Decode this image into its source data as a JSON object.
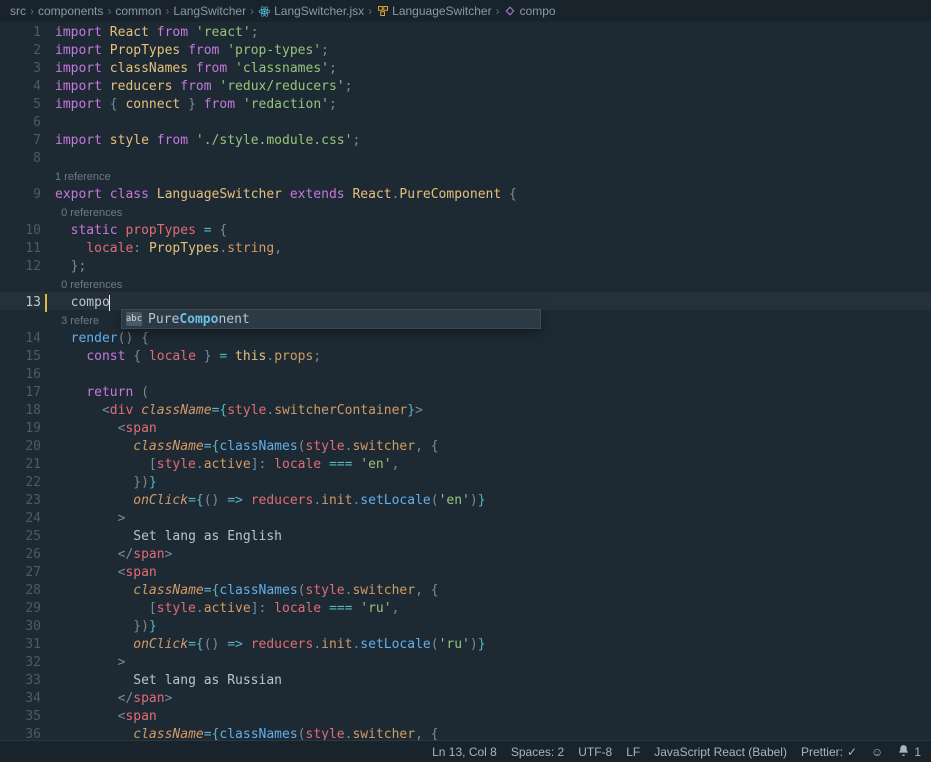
{
  "breadcrumb": [
    {
      "label": "src",
      "icon": null
    },
    {
      "label": "components",
      "icon": null
    },
    {
      "label": "common",
      "icon": null
    },
    {
      "label": "LangSwitcher",
      "icon": null
    },
    {
      "label": "LangSwitcher.jsx",
      "icon": "react-file-icon"
    },
    {
      "label": "LanguageSwitcher",
      "icon": "symbol-class-icon"
    },
    {
      "label": "compo",
      "icon": "symbol-method-icon"
    }
  ],
  "codelens": {
    "ref0": "0 references",
    "ref1": "1 reference",
    "ref3": "3 refere"
  },
  "lines": {
    "1": [
      [
        "kw",
        "import"
      ],
      [
        "plain",
        " "
      ],
      [
        "def",
        "React"
      ],
      [
        "plain",
        " "
      ],
      [
        "kw",
        "from"
      ],
      [
        "plain",
        " "
      ],
      [
        "str",
        "'react'"
      ],
      [
        "punct",
        ";"
      ]
    ],
    "2": [
      [
        "kw",
        "import"
      ],
      [
        "plain",
        " "
      ],
      [
        "def",
        "PropTypes"
      ],
      [
        "plain",
        " "
      ],
      [
        "kw",
        "from"
      ],
      [
        "plain",
        " "
      ],
      [
        "str",
        "'prop-types'"
      ],
      [
        "punct",
        ";"
      ]
    ],
    "3": [
      [
        "kw",
        "import"
      ],
      [
        "plain",
        " "
      ],
      [
        "def",
        "classNames"
      ],
      [
        "plain",
        " "
      ],
      [
        "kw",
        "from"
      ],
      [
        "plain",
        " "
      ],
      [
        "str",
        "'classnames'"
      ],
      [
        "punct",
        ";"
      ]
    ],
    "4": [
      [
        "kw",
        "import"
      ],
      [
        "plain",
        " "
      ],
      [
        "def",
        "reducers"
      ],
      [
        "plain",
        " "
      ],
      [
        "kw",
        "from"
      ],
      [
        "plain",
        " "
      ],
      [
        "str",
        "'redux/reducers'"
      ],
      [
        "punct",
        ";"
      ]
    ],
    "5": [
      [
        "kw",
        "import"
      ],
      [
        "plain",
        " "
      ],
      [
        "punct",
        "{ "
      ],
      [
        "def",
        "connect"
      ],
      [
        "punct",
        " }"
      ],
      [
        "plain",
        " "
      ],
      [
        "kw",
        "from"
      ],
      [
        "plain",
        " "
      ],
      [
        "str",
        "'redaction'"
      ],
      [
        "punct",
        ";"
      ]
    ],
    "6": [],
    "7": [
      [
        "kw",
        "import"
      ],
      [
        "plain",
        " "
      ],
      [
        "def",
        "style"
      ],
      [
        "plain",
        " "
      ],
      [
        "kw",
        "from"
      ],
      [
        "plain",
        " "
      ],
      [
        "str",
        "'./style.module.css'"
      ],
      [
        "punct",
        ";"
      ]
    ],
    "8": [],
    "9": [
      [
        "kw",
        "export"
      ],
      [
        "plain",
        " "
      ],
      [
        "kw",
        "class"
      ],
      [
        "plain",
        " "
      ],
      [
        "def",
        "LanguageSwitcher"
      ],
      [
        "plain",
        " "
      ],
      [
        "kw",
        "extends"
      ],
      [
        "plain",
        " "
      ],
      [
        "def",
        "React"
      ],
      [
        "punct",
        "."
      ],
      [
        "def",
        "PureComponent"
      ],
      [
        "plain",
        " "
      ],
      [
        "punct",
        "{"
      ]
    ],
    "10": [
      [
        "plain",
        "  "
      ],
      [
        "kw",
        "static"
      ],
      [
        "plain",
        " "
      ],
      [
        "id",
        "propTypes"
      ],
      [
        "plain",
        " "
      ],
      [
        "op",
        "="
      ],
      [
        "plain",
        " "
      ],
      [
        "punct",
        "{"
      ]
    ],
    "11": [
      [
        "plain",
        "    "
      ],
      [
        "id",
        "locale"
      ],
      [
        "punct",
        ":"
      ],
      [
        "plain",
        " "
      ],
      [
        "def",
        "PropTypes"
      ],
      [
        "punct",
        "."
      ],
      [
        "prop",
        "string"
      ],
      [
        "punct",
        ","
      ]
    ],
    "12": [
      [
        "plain",
        "  "
      ],
      [
        "punct",
        "};"
      ]
    ],
    "13": [
      [
        "plain",
        "  "
      ],
      [
        "plain",
        "compo"
      ]
    ],
    "14": [
      [
        "plain",
        "  "
      ],
      [
        "fn",
        "render"
      ],
      [
        "punct",
        "()"
      ],
      [
        "plain",
        " "
      ],
      [
        "punct",
        "{"
      ]
    ],
    "15": [
      [
        "plain",
        "    "
      ],
      [
        "kw",
        "const"
      ],
      [
        "plain",
        " "
      ],
      [
        "punct",
        "{ "
      ],
      [
        "id",
        "locale"
      ],
      [
        "punct",
        " }"
      ],
      [
        "plain",
        " "
      ],
      [
        "op",
        "="
      ],
      [
        "plain",
        " "
      ],
      [
        "this",
        "this"
      ],
      [
        "punct",
        "."
      ],
      [
        "prop",
        "props"
      ],
      [
        "punct",
        ";"
      ]
    ],
    "16": [],
    "17": [
      [
        "plain",
        "    "
      ],
      [
        "kw",
        "return"
      ],
      [
        "plain",
        " "
      ],
      [
        "punct",
        "("
      ]
    ],
    "18": [
      [
        "plain",
        "      "
      ],
      [
        "punct",
        "<"
      ],
      [
        "tag",
        "div"
      ],
      [
        "plain",
        " "
      ],
      [
        "attr",
        "className"
      ],
      [
        "op",
        "="
      ],
      [
        "jsxbr",
        "{"
      ],
      [
        "id",
        "style"
      ],
      [
        "punct",
        "."
      ],
      [
        "prop",
        "switcherContainer"
      ],
      [
        "jsxbr",
        "}"
      ],
      [
        "punct",
        ">"
      ]
    ],
    "19": [
      [
        "plain",
        "        "
      ],
      [
        "punct",
        "<"
      ],
      [
        "tag",
        "span"
      ]
    ],
    "20": [
      [
        "plain",
        "          "
      ],
      [
        "attr",
        "className"
      ],
      [
        "op",
        "="
      ],
      [
        "jsxbr",
        "{"
      ],
      [
        "fn",
        "classNames"
      ],
      [
        "punct",
        "("
      ],
      [
        "id",
        "style"
      ],
      [
        "punct",
        "."
      ],
      [
        "prop",
        "switcher"
      ],
      [
        "punct",
        ","
      ],
      [
        "plain",
        " "
      ],
      [
        "punct",
        "{"
      ]
    ],
    "21": [
      [
        "plain",
        "            "
      ],
      [
        "punct",
        "["
      ],
      [
        "id",
        "style"
      ],
      [
        "punct",
        "."
      ],
      [
        "prop",
        "active"
      ],
      [
        "punct",
        "]"
      ],
      [
        "punct",
        ":"
      ],
      [
        "plain",
        " "
      ],
      [
        "id",
        "locale"
      ],
      [
        "plain",
        " "
      ],
      [
        "op",
        "==="
      ],
      [
        "plain",
        " "
      ],
      [
        "str",
        "'en'"
      ],
      [
        "punct",
        ","
      ]
    ],
    "22": [
      [
        "plain",
        "          "
      ],
      [
        "punct",
        "})"
      ],
      [
        "jsxbr",
        "}"
      ]
    ],
    "23": [
      [
        "plain",
        "          "
      ],
      [
        "attr",
        "onClick"
      ],
      [
        "op",
        "="
      ],
      [
        "jsxbr",
        "{"
      ],
      [
        "punct",
        "()"
      ],
      [
        "plain",
        " "
      ],
      [
        "op",
        "=>"
      ],
      [
        "plain",
        " "
      ],
      [
        "id",
        "reducers"
      ],
      [
        "punct",
        "."
      ],
      [
        "prop",
        "init"
      ],
      [
        "punct",
        "."
      ],
      [
        "fn",
        "setLocale"
      ],
      [
        "punct",
        "("
      ],
      [
        "str",
        "'en'"
      ],
      [
        "punct",
        ")"
      ],
      [
        "jsxbr",
        "}"
      ]
    ],
    "24": [
      [
        "plain",
        "        "
      ],
      [
        "punct",
        ">"
      ]
    ],
    "25": [
      [
        "plain",
        "          "
      ],
      [
        "plain",
        "Set lang as English"
      ]
    ],
    "26": [
      [
        "plain",
        "        "
      ],
      [
        "punct",
        "</"
      ],
      [
        "tag",
        "span"
      ],
      [
        "punct",
        ">"
      ]
    ],
    "27": [
      [
        "plain",
        "        "
      ],
      [
        "punct",
        "<"
      ],
      [
        "tag",
        "span"
      ]
    ],
    "28": [
      [
        "plain",
        "          "
      ],
      [
        "attr",
        "className"
      ],
      [
        "op",
        "="
      ],
      [
        "jsxbr",
        "{"
      ],
      [
        "fn",
        "classNames"
      ],
      [
        "punct",
        "("
      ],
      [
        "id",
        "style"
      ],
      [
        "punct",
        "."
      ],
      [
        "prop",
        "switcher"
      ],
      [
        "punct",
        ","
      ],
      [
        "plain",
        " "
      ],
      [
        "punct",
        "{"
      ]
    ],
    "29": [
      [
        "plain",
        "            "
      ],
      [
        "punct",
        "["
      ],
      [
        "id",
        "style"
      ],
      [
        "punct",
        "."
      ],
      [
        "prop",
        "active"
      ],
      [
        "punct",
        "]"
      ],
      [
        "punct",
        ":"
      ],
      [
        "plain",
        " "
      ],
      [
        "id",
        "locale"
      ],
      [
        "plain",
        " "
      ],
      [
        "op",
        "==="
      ],
      [
        "plain",
        " "
      ],
      [
        "str",
        "'ru'"
      ],
      [
        "punct",
        ","
      ]
    ],
    "30": [
      [
        "plain",
        "          "
      ],
      [
        "punct",
        "})"
      ],
      [
        "jsxbr",
        "}"
      ]
    ],
    "31": [
      [
        "plain",
        "          "
      ],
      [
        "attr",
        "onClick"
      ],
      [
        "op",
        "="
      ],
      [
        "jsxbr",
        "{"
      ],
      [
        "punct",
        "()"
      ],
      [
        "plain",
        " "
      ],
      [
        "op",
        "=>"
      ],
      [
        "plain",
        " "
      ],
      [
        "id",
        "reducers"
      ],
      [
        "punct",
        "."
      ],
      [
        "prop",
        "init"
      ],
      [
        "punct",
        "."
      ],
      [
        "fn",
        "setLocale"
      ],
      [
        "punct",
        "("
      ],
      [
        "str",
        "'ru'"
      ],
      [
        "punct",
        ")"
      ],
      [
        "jsxbr",
        "}"
      ]
    ],
    "32": [
      [
        "plain",
        "        "
      ],
      [
        "punct",
        ">"
      ]
    ],
    "33": [
      [
        "plain",
        "          "
      ],
      [
        "plain",
        "Set lang as Russian"
      ]
    ],
    "34": [
      [
        "plain",
        "        "
      ],
      [
        "punct",
        "</"
      ],
      [
        "tag",
        "span"
      ],
      [
        "punct",
        ">"
      ]
    ],
    "35": [
      [
        "plain",
        "        "
      ],
      [
        "punct",
        "<"
      ],
      [
        "tag",
        "span"
      ]
    ],
    "36": [
      [
        "plain",
        "          "
      ],
      [
        "attr",
        "className"
      ],
      [
        "op",
        "="
      ],
      [
        "jsxbr",
        "{"
      ],
      [
        "fn",
        "classNames"
      ],
      [
        "punct",
        "("
      ],
      [
        "id",
        "style"
      ],
      [
        "punct",
        "."
      ],
      [
        "prop",
        "switcher"
      ],
      [
        "punct",
        ","
      ],
      [
        "plain",
        " "
      ],
      [
        "punct",
        "{"
      ]
    ]
  },
  "line_numbers": [
    "1",
    "2",
    "3",
    "4",
    "5",
    "6",
    "7",
    "8",
    "9",
    "10",
    "11",
    "12",
    "13",
    "14",
    "15",
    "16",
    "17",
    "18",
    "19",
    "20",
    "21",
    "22",
    "23",
    "24",
    "25",
    "26",
    "27",
    "28",
    "29",
    "30",
    "31",
    "32",
    "33",
    "34",
    "35",
    "36"
  ],
  "active_line": "13",
  "codelens_indent": {
    "ref1": "",
    "ref0": "  ",
    "ref3": "  "
  },
  "suggest": {
    "prefix": "Pure",
    "match": "Compo",
    "suffix": "nent",
    "kind_glyph": "abc"
  },
  "statusbar": {
    "position": "Ln 13, Col 8",
    "spaces": "Spaces: 2",
    "encoding": "UTF-8",
    "eol": "LF",
    "language": "JavaScript React (Babel)",
    "prettier": "Prettier:",
    "notifications": "1"
  }
}
